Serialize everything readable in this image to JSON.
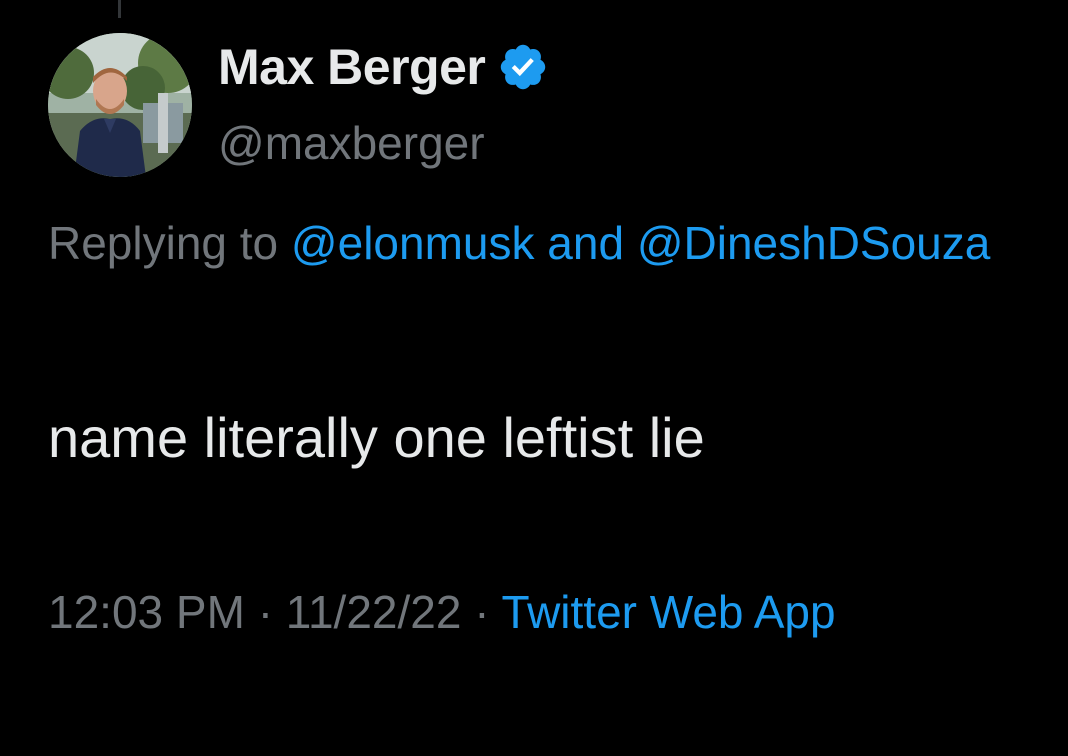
{
  "author": {
    "display_name": "Max Berger",
    "handle": "@maxberger",
    "verified_icon": "verified-badge-icon"
  },
  "reply": {
    "prefix": "Replying to",
    "mention_1": "@elonmusk",
    "connector": "and",
    "mention_2": "@DineshDSouza"
  },
  "tweet": {
    "text": "name literally one leftist lie"
  },
  "meta": {
    "time": "12:03 PM",
    "separator": "·",
    "date": "11/22/22",
    "source": "Twitter Web App"
  },
  "colors": {
    "background": "#000000",
    "primary_text": "#e7e9ea",
    "secondary_text": "#71767b",
    "accent": "#1d9bf0"
  }
}
